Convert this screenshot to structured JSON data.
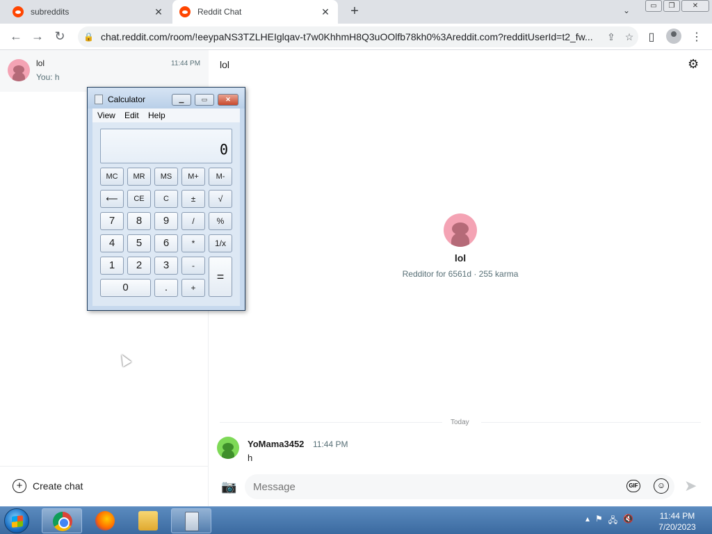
{
  "browser": {
    "tabs": [
      {
        "label": "subreddits",
        "close": "✕"
      },
      {
        "label": "Reddit Chat",
        "close": "✕"
      }
    ],
    "new_tab": "+",
    "tab_search": "⌄",
    "window_buttons": {
      "minimize": "▭",
      "restore": "❐",
      "close": "✕"
    },
    "nav": {
      "back": "←",
      "forward": "→",
      "reload": "↻"
    },
    "url": "chat.reddit.com/room/!eeypaNS3TZLHEIglqav-t7w0KhhmH8Q3uOOlfb78kh0%3Areddit.com?redditUserId=t2_fw...",
    "lock": "🔒",
    "share_icon": "⇪",
    "star_icon": "☆",
    "sidepanel_icon": "▯",
    "menu_icon": "⋮"
  },
  "sidebar": {
    "chats": [
      {
        "name": "lol",
        "preview": "You: h",
        "time": "11:44 PM"
      }
    ],
    "create_chat": {
      "icon": "+",
      "label": "Create chat"
    }
  },
  "main": {
    "room_title": "lol",
    "settings_icon": "⚙",
    "profile": {
      "name": "lol",
      "meta": "Redditor for 6561d · 255 karma"
    },
    "divider_label": "Today",
    "messages": [
      {
        "author": "YoMama3452",
        "time": "11:44 PM",
        "text": "h"
      }
    ],
    "composer": {
      "camera_icon": "📷",
      "placeholder": "Message",
      "gif_label": "GIF",
      "emoji_icon": "☺",
      "send_icon": "➤"
    }
  },
  "calculator": {
    "title": "Calculator",
    "title_buttons": {
      "minimize": "▁",
      "maximize": "▭",
      "close": "✕"
    },
    "menus": [
      "View",
      "Edit",
      "Help"
    ],
    "display": "0",
    "keys": {
      "mc": "MC",
      "mr": "MR",
      "ms": "MS",
      "mplus": "M+",
      "mminus": "M-",
      "back": "⟵",
      "ce": "CE",
      "c": "C",
      "plusminus": "±",
      "sqrt": "√",
      "k7": "7",
      "k8": "8",
      "k9": "9",
      "div": "/",
      "pct": "%",
      "k4": "4",
      "k5": "5",
      "k6": "6",
      "mul": "*",
      "recip": "1/x",
      "k1": "1",
      "k2": "2",
      "k3": "3",
      "minus": "-",
      "equals": "=",
      "k0": "0",
      "dot": ".",
      "plus": "+"
    }
  },
  "taskbar": {
    "tray_icons": [
      "▴",
      "⚑",
      "🖧",
      "🔇"
    ],
    "time": "11:44 PM",
    "date": "7/20/2023"
  }
}
